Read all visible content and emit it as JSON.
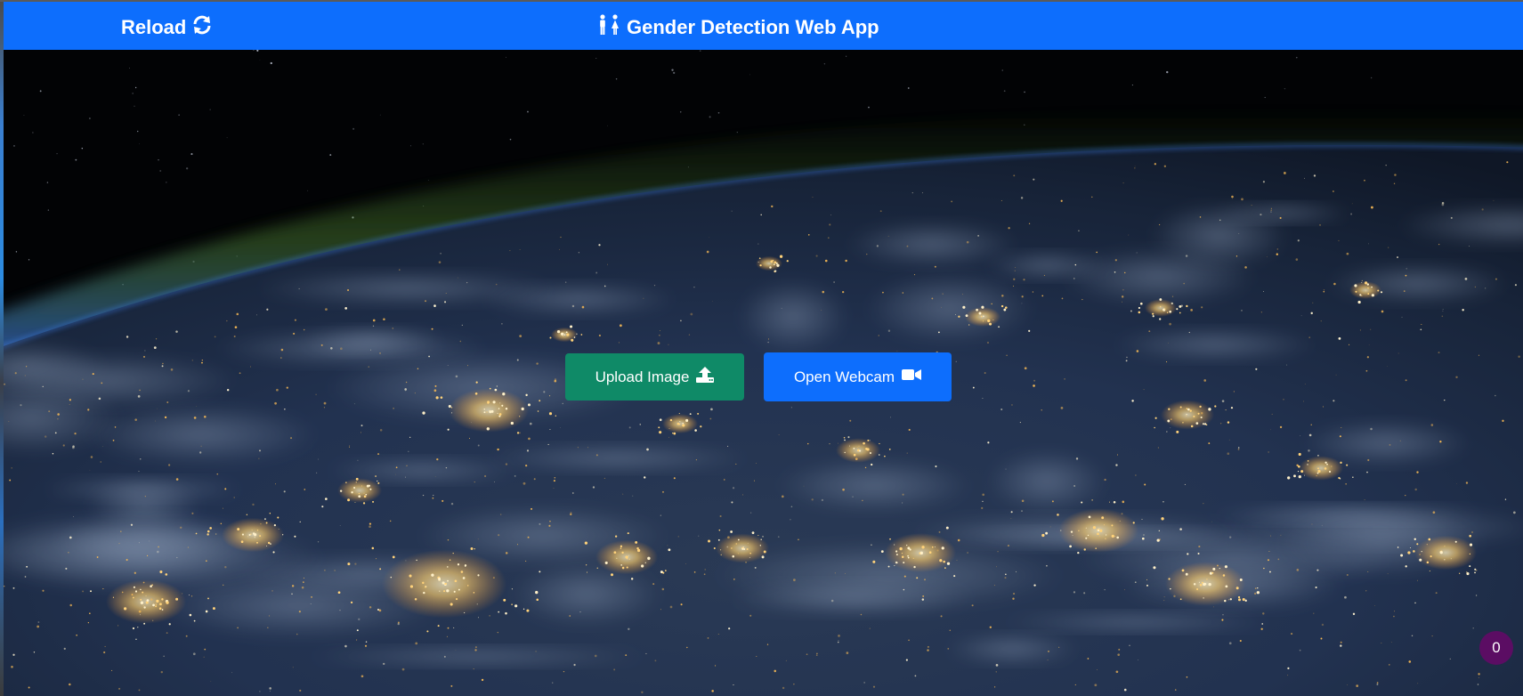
{
  "navbar": {
    "reload_label": "Reload",
    "reload_icon": "sync-icon",
    "title": "Gender Detection Web App",
    "title_icon": "male-female-icon",
    "background": "#0d6efd"
  },
  "actions": {
    "upload_label": "Upload Image",
    "upload_icon": "upload-icon",
    "upload_color": "#0f8a67",
    "webcam_label": "Open Webcam",
    "webcam_icon": "video-camera-icon",
    "webcam_color": "#0d6efd"
  },
  "badge": {
    "count": "0",
    "color": "#5b0d63"
  },
  "background": {
    "description_icon": "earth-at-night-image"
  }
}
